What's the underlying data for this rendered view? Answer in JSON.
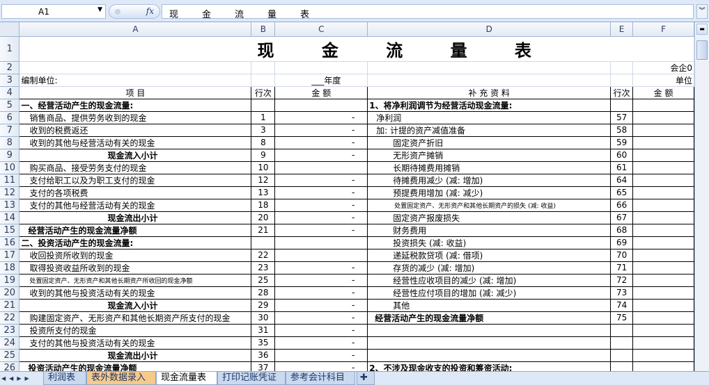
{
  "formula_bar": {
    "name_box": "A1",
    "fx_label": "fx",
    "content": "现金流量表"
  },
  "columns": [
    "A",
    "B",
    "C",
    "D",
    "E",
    "F"
  ],
  "rows": [
    "1",
    "2",
    "3",
    "4",
    "5",
    "6",
    "7",
    "8",
    "9",
    "10",
    "11",
    "12",
    "13",
    "14",
    "15",
    "16",
    "17",
    "18",
    "19",
    "20",
    "21",
    "22",
    "23",
    "24",
    "25",
    "26"
  ],
  "sheet": {
    "title": "现 金 流 量 表",
    "company_note": "会企0",
    "unit_note": "单位",
    "compiler": "编制单位:",
    "year": "___年度",
    "head": {
      "item": "项          目",
      "line_no": "行次",
      "amount": "金    额",
      "supplement": "补 充 资 料",
      "line_no2": "行次",
      "amount2": "金    额"
    },
    "left": [
      {
        "label": "一、经营活动产生的现金流量:",
        "line": "",
        "amt": "",
        "style": "bold"
      },
      {
        "label": "销售商品、提供劳务收到的现金",
        "line": "1",
        "amt": "-",
        "style": "ind"
      },
      {
        "label": "收到的税费返还",
        "line": "3",
        "amt": "-",
        "style": "ind"
      },
      {
        "label": "收到的其他与经营活动有关的现金",
        "line": "8",
        "amt": "-",
        "style": "ind"
      },
      {
        "label": "现金流入小计",
        "line": "9",
        "amt": "-",
        "style": "subtotal"
      },
      {
        "label": "购买商品、接受劳务支付的现金",
        "line": "10",
        "amt": "",
        "style": "ind"
      },
      {
        "label": "支付给职工以及为职工支付的现金",
        "line": "12",
        "amt": "-",
        "style": "ind"
      },
      {
        "label": "支付的各项税费",
        "line": "13",
        "amt": "-",
        "style": "ind"
      },
      {
        "label": "支付的其他与经营活动有关的现金",
        "line": "18",
        "amt": "-",
        "style": "ind"
      },
      {
        "label": "现金流出小计",
        "line": "20",
        "amt": "-",
        "style": "subtotal"
      },
      {
        "label": "经营活动产生的现金流量净额",
        "line": "21",
        "amt": "-",
        "style": "boldind"
      },
      {
        "label": "二、投资活动产生的现金流量:",
        "line": "",
        "amt": "",
        "style": "bold"
      },
      {
        "label": "收回投资所收到的现金",
        "line": "22",
        "amt": "",
        "style": "ind"
      },
      {
        "label": "取得投资收益所收到的现金",
        "line": "23",
        "amt": "-",
        "style": "ind"
      },
      {
        "label": "处置固定资产、无形资产和其他长期资产所收回的现金净额",
        "line": "25",
        "amt": "-",
        "style": "small"
      },
      {
        "label": "收到的其他与投资活动有关的现金",
        "line": "28",
        "amt": "-",
        "style": "ind"
      },
      {
        "label": "现金流入小计",
        "line": "29",
        "amt": "-",
        "style": "subtotal"
      },
      {
        "label": "购建固定资产、无形资产和其他长期资产所支付的现金",
        "line": "30",
        "amt": "-",
        "style": "ind"
      },
      {
        "label": "投资所支付的现金",
        "line": "31",
        "amt": "-",
        "style": "ind"
      },
      {
        "label": "支付的其他与投资活动有关的现金",
        "line": "35",
        "amt": "-",
        "style": "ind"
      },
      {
        "label": "现金流出小计",
        "line": "36",
        "amt": "-",
        "style": "subtotal"
      },
      {
        "label": "投资活动产生的现金流量净额",
        "line": "37",
        "amt": "-",
        "style": "boldind"
      }
    ],
    "right": [
      {
        "label": "1、将净利润调节为经营活动现金流量:",
        "line": "",
        "style": "bold"
      },
      {
        "label": "净利润",
        "line": "57",
        "style": "ind1"
      },
      {
        "label": "加: 计提的资产减值准备",
        "line": "58",
        "style": "ind1"
      },
      {
        "label": "固定资产折旧",
        "line": "59",
        "style": "ind2"
      },
      {
        "label": "无形资产摊销",
        "line": "60",
        "style": "ind2"
      },
      {
        "label": "长期待摊费用摊销",
        "line": "61",
        "style": "ind2"
      },
      {
        "label": "待摊费用减少 (减: 增加)",
        "line": "64",
        "style": "ind2"
      },
      {
        "label": "预提费用增加 (减: 减少)",
        "line": "65",
        "style": "ind2"
      },
      {
        "label": "处置固定资产、无形资产和其他长期资产的损失 (减: 收益)",
        "line": "66",
        "style": "small2"
      },
      {
        "label": "固定资产报废损失",
        "line": "67",
        "style": "ind2"
      },
      {
        "label": "财务费用",
        "line": "68",
        "style": "ind2"
      },
      {
        "label": "投资损失 (减: 收益)",
        "line": "69",
        "style": "ind2"
      },
      {
        "label": "递延税款贷项 (减: 借项)",
        "line": "70",
        "style": "ind2"
      },
      {
        "label": "存货的减少 (减: 增加)",
        "line": "71",
        "style": "ind2"
      },
      {
        "label": "经营性应收项目的减少 (减: 增加)",
        "line": "72",
        "style": "ind2"
      },
      {
        "label": "经营性应付项目的增加 (减: 减少)",
        "line": "73",
        "style": "ind2"
      },
      {
        "label": "其他",
        "line": "74",
        "style": "ind2"
      },
      {
        "label": "经营活动产生的现金流量净额",
        "line": "75",
        "style": "boldind"
      },
      {
        "label": "",
        "line": "",
        "style": ""
      },
      {
        "label": "",
        "line": "",
        "style": ""
      },
      {
        "label": "",
        "line": "",
        "style": ""
      },
      {
        "label": "2、不涉及现金收支的投资和筹资活动:",
        "line": "",
        "style": "bold"
      }
    ]
  },
  "tabs": [
    {
      "label": "利润表",
      "state": "normal"
    },
    {
      "label": "表外数据录入",
      "state": "orange"
    },
    {
      "label": "现金流量表",
      "state": "active"
    },
    {
      "label": "打印记账凭证",
      "state": "normal"
    },
    {
      "label": "参考会计科目",
      "state": "normal"
    }
  ]
}
